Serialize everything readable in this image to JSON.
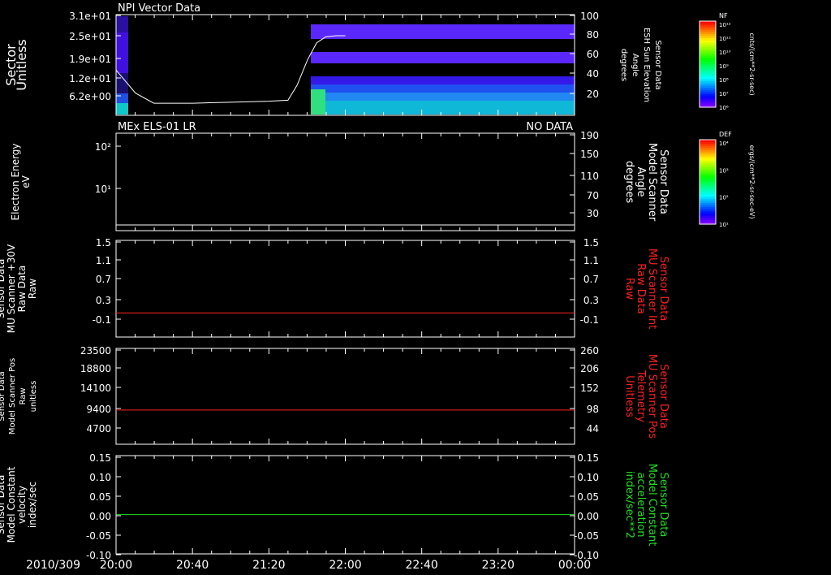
{
  "figure": {
    "date_label": "2010/309",
    "time_ticks": [
      "20:00",
      "20:40",
      "21:20",
      "22:00",
      "22:40",
      "23:20",
      "00:00"
    ]
  },
  "colorbars": [
    {
      "title": "NF",
      "unit": "cnts/(cm**2-sr-sec)",
      "tick_labels": [
        "10¹²",
        "10¹¹",
        "10¹⁰",
        "10⁹",
        "10⁸",
        "10⁷",
        "10⁶"
      ]
    },
    {
      "title": "DEF",
      "unit": "ergs/(cm**2-sr-sec-eV)",
      "tick_labels": [
        "10⁴",
        "10³",
        "10²",
        "10¹"
      ]
    }
  ],
  "chart_data": [
    {
      "type": "heatmap",
      "title": "NPI Vector Data",
      "ylabel": [
        "Sector",
        "Unitless"
      ],
      "yticks": [
        "3.1e+01",
        "2.5e+01",
        "1.9e+01",
        "1.2e+01",
        "6.2e+00"
      ],
      "y2label": [
        "Sensor Data",
        "ESH Sun Elevation",
        "Angle",
        "degrees"
      ],
      "y2ticks": [
        "100",
        "80",
        "60",
        "40",
        "20"
      ],
      "y2lim": [
        0,
        100
      ],
      "overlay_line": {
        "x_hours": [
          20.0,
          20.17,
          20.33,
          20.67,
          21.0,
          21.33,
          21.5,
          21.58,
          21.67,
          21.75,
          21.83,
          21.92,
          22.0
        ],
        "y_degrees": [
          45,
          22,
          12,
          12,
          13,
          14,
          15,
          30,
          55,
          72,
          78,
          79,
          79
        ]
      }
    },
    {
      "type": "heatmap",
      "title": "MEx ELS-01 LR",
      "status": "NO DATA",
      "ylabel": [
        "Electron Energy",
        "eV"
      ],
      "yticks": [
        "10²",
        "10¹"
      ],
      "y2label": [
        "Sensor Data",
        "Model Scanner",
        "Angle",
        "degrees"
      ],
      "y2ticks": [
        "190",
        "150",
        "110",
        "70",
        "30"
      ],
      "y2lim": [
        0,
        190
      ],
      "series": [
        {
          "x_hours": [
            20.0,
            24.0
          ],
          "y": [
            11,
            11
          ]
        }
      ]
    },
    {
      "type": "line",
      "ylabel": [
        "Sensor Data",
        "MU Scanner +30V",
        "Raw Data",
        "Raw"
      ],
      "yticks": [
        "1.5",
        "1.1",
        "0.7",
        "0.3",
        "-0.1"
      ],
      "ylim": [
        -0.5,
        1.5
      ],
      "y2label": [
        "Sensor Data",
        "MU Scanner Int",
        "Raw Data",
        "Raw"
      ],
      "y2ticks": [
        "1.5",
        "1.1",
        "0.7",
        "0.3",
        "-0.1"
      ],
      "series": [
        {
          "color": "#ff2020",
          "x_hours": [
            20.0,
            24.0
          ],
          "y": [
            0.0,
            0.0
          ]
        }
      ]
    },
    {
      "type": "line",
      "ylabel": [
        "Sensor Data",
        "Model Scanner Pos",
        "Raw",
        "unitless"
      ],
      "yticks": [
        "23500",
        "18800",
        "14100",
        "9400",
        "4700"
      ],
      "ylim": [
        0,
        23500
      ],
      "y2label": [
        "Sensor Data",
        "MU Scanner Pos",
        "Telemetry",
        "Unitless"
      ],
      "y2ticks": [
        "260",
        "206",
        "152",
        "98",
        "44"
      ],
      "series": [
        {
          "color": "#ff2020",
          "x_hours": [
            20.0,
            24.0
          ],
          "y": [
            8400,
            8400
          ]
        }
      ]
    },
    {
      "type": "line",
      "ylabel": [
        "Sensor Data",
        "Model Constant",
        "velocity",
        "index/sec"
      ],
      "yticks": [
        "0.15",
        "0.10",
        "0.05",
        "0.00",
        "-0.05",
        "-0.10"
      ],
      "ylim": [
        -0.1,
        0.15
      ],
      "y2label": [
        "Sensor Data",
        "Model Constant",
        "acceleration",
        "index/sec**2"
      ],
      "y2ticks": [
        "0.15",
        "0.10",
        "0.05",
        "0.00",
        "-0.05",
        "-0.10"
      ],
      "series": [
        {
          "color": "#20e020",
          "x_hours": [
            20.0,
            24.0
          ],
          "y": [
            0.0,
            0.0
          ]
        }
      ]
    }
  ]
}
